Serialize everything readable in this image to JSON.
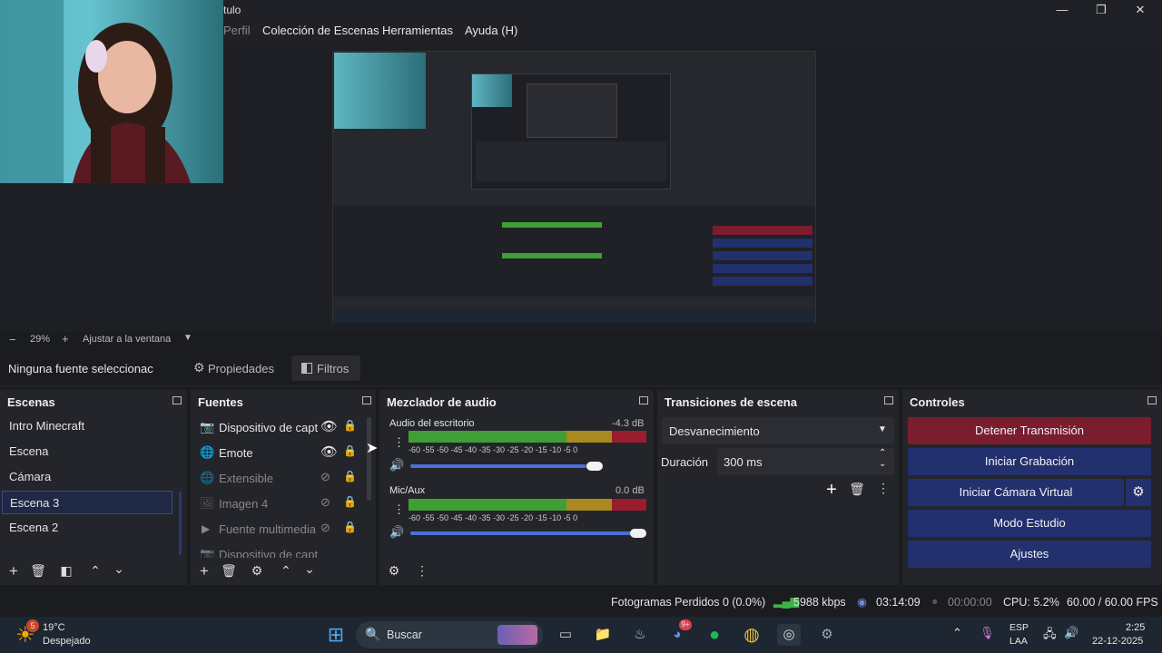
{
  "window": {
    "title_fragment": "tulo",
    "controls": [
      "—",
      "❐",
      "✕"
    ]
  },
  "menu": [
    "Perfil",
    "Colección de Escenas",
    "Herramientas",
    "Ayuda (H)"
  ],
  "zoom": {
    "minus": "−",
    "value": "29%",
    "plus": "+",
    "fit_label": "Ajustar a la ventana"
  },
  "source_bar": {
    "selection": "Ninguna fuente seleccionac",
    "properties": "Propiedades",
    "filters": "Filtros"
  },
  "scenes": {
    "title": "Escenas",
    "items": [
      "Intro Minecraft",
      "Escena",
      "Cámara",
      "Escena 3",
      "Escena 2"
    ],
    "selected_index": 3
  },
  "sources": {
    "title": "Fuentes",
    "items": [
      {
        "label": "Dispositivo de capt",
        "icon": "camera-icon",
        "visible": true
      },
      {
        "label": "Emote",
        "icon": "globe-icon",
        "visible": true
      },
      {
        "label": "Extensible",
        "icon": "globe-icon",
        "visible": false
      },
      {
        "label": "Imagen 4",
        "icon": "image-icon",
        "visible": false
      },
      {
        "label": "Fuente multimedia",
        "icon": "play-icon",
        "visible": false
      },
      {
        "label": "Dispositivo de capt",
        "icon": "camera-icon",
        "visible": false
      }
    ]
  },
  "mixer": {
    "title": "Mezclador de audio",
    "channels": [
      {
        "name": "Audio del escritorio",
        "db": "-4.3 dB",
        "volume": 0.92
      },
      {
        "name": "Mic/Aux",
        "db": "0.0 dB",
        "volume": 1.0
      }
    ],
    "ticks": "-60 -55 -50 -45 -40 -35 -30 -25 -20 -15 -10  -5   0"
  },
  "transitions": {
    "title": "Transiciones de escena",
    "selected": "Desvanecimiento",
    "duration_label": "Duración",
    "duration_value": "300 ms"
  },
  "controls": {
    "title": "Controles",
    "stop_stream": "Detener Transmisión",
    "start_recording": "Iniciar Grabación",
    "virtual_cam": "Iniciar Cámara Virtual",
    "studio_mode": "Modo Estudio",
    "settings": "Ajustes"
  },
  "status": {
    "dropped": "Fotogramas Perdidos 0 (0.0%)",
    "bitrate": "5988 kbps",
    "live_time": "03:14:09",
    "rec_time": "00:00:00",
    "cpu": "CPU: 5.2%",
    "fps": "60.00 / 60.00 FPS"
  },
  "taskbar": {
    "weather_temp": "19°C",
    "weather_desc": "Despejado",
    "weather_badge": "5",
    "search": "Buscar",
    "lang1": "ESP",
    "lang2": "LAA",
    "time": "2:25",
    "date": "22-12-2025",
    "discord_badge": "9+"
  },
  "colors": {
    "stop_stream": "#7a1d2e",
    "primary_btn": "#22306e",
    "accent_meter": "#3f9e36"
  }
}
